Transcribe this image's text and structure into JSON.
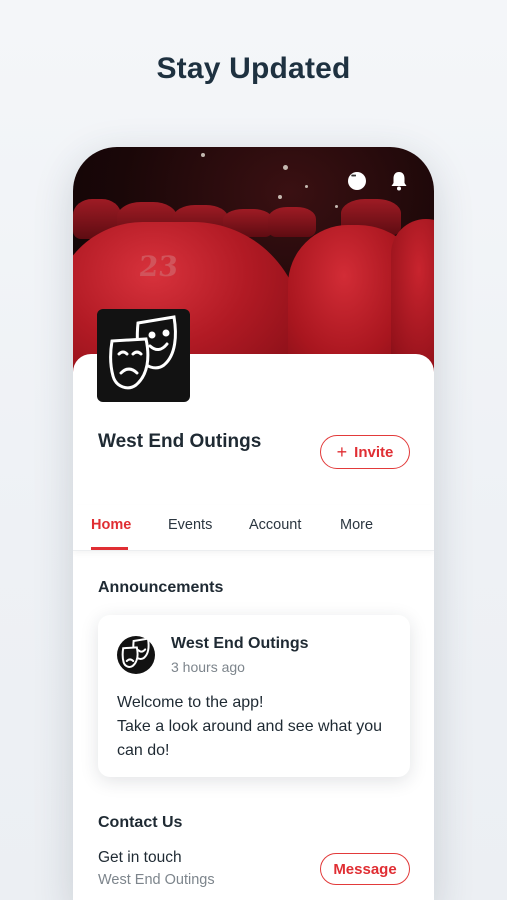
{
  "headline": "Stay Updated",
  "hero": {
    "seat_number": "23"
  },
  "group": {
    "name": "West End Outings",
    "invite_label": "Invite"
  },
  "tabs": [
    {
      "label": "Home",
      "active": true
    },
    {
      "label": "Events",
      "active": false
    },
    {
      "label": "Account",
      "active": false
    },
    {
      "label": "More",
      "active": false
    }
  ],
  "announcements": {
    "title": "Announcements",
    "post": {
      "author": "West End Outings",
      "time": "3 hours ago",
      "line1": "Welcome to the app!",
      "line2": "Take a look around and see what you can do!"
    }
  },
  "contact": {
    "title": "Contact Us",
    "line": "Get in touch",
    "sub": "West End Outings",
    "button_label": "Message"
  },
  "colors": {
    "accent": "#e02e33",
    "headline": "#1e3140",
    "seat_red": "#b11a24"
  },
  "icons": [
    "chat-icon",
    "bell-icon",
    "theater-masks-icon",
    "plus-icon"
  ]
}
